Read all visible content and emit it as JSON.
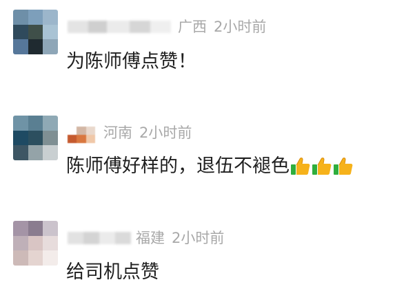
{
  "comments": [
    {
      "location": "广西",
      "time": "2小时前",
      "text": "为陈师傅点赞！",
      "avatar_colors": [
        "#6e8fa8",
        "#7d9fbb",
        "#9cb6cb",
        "#2f4a5c",
        "#3f4f49",
        "#a9c3d4",
        "#56779a",
        "#1f2a30",
        "#8ea6b7"
      ]
    },
    {
      "location": "河南",
      "time": "2小时前",
      "text": "陈师傅好样的，退伍不褪色",
      "emoji": [
        "thumbs-up",
        "thumbs-up",
        "thumbs-up"
      ],
      "avatar_colors": [
        "#6f93a6",
        "#5a7f92",
        "#8fa9b5",
        "#1e4a63",
        "#2c4f5f",
        "#7f8f93",
        "#3d5664",
        "#94a3a8",
        "#c9cfd1"
      ],
      "name_mosaic_colors": [
        "#ffffff",
        "#d3b7a5",
        "#e9d8cc",
        "#c55a2e",
        "#d9773f",
        "#f0c8a8"
      ]
    },
    {
      "location": "福建",
      "time": "2小时前",
      "text": "给司机点赞",
      "avatar_colors": [
        "#a494a6",
        "#8a7c8f",
        "#cbc3cc",
        "#bfb0b8",
        "#d9c5c4",
        "#e7dcdc",
        "#cdbab8",
        "#e4d4d0",
        "#f3ecea"
      ]
    }
  ]
}
